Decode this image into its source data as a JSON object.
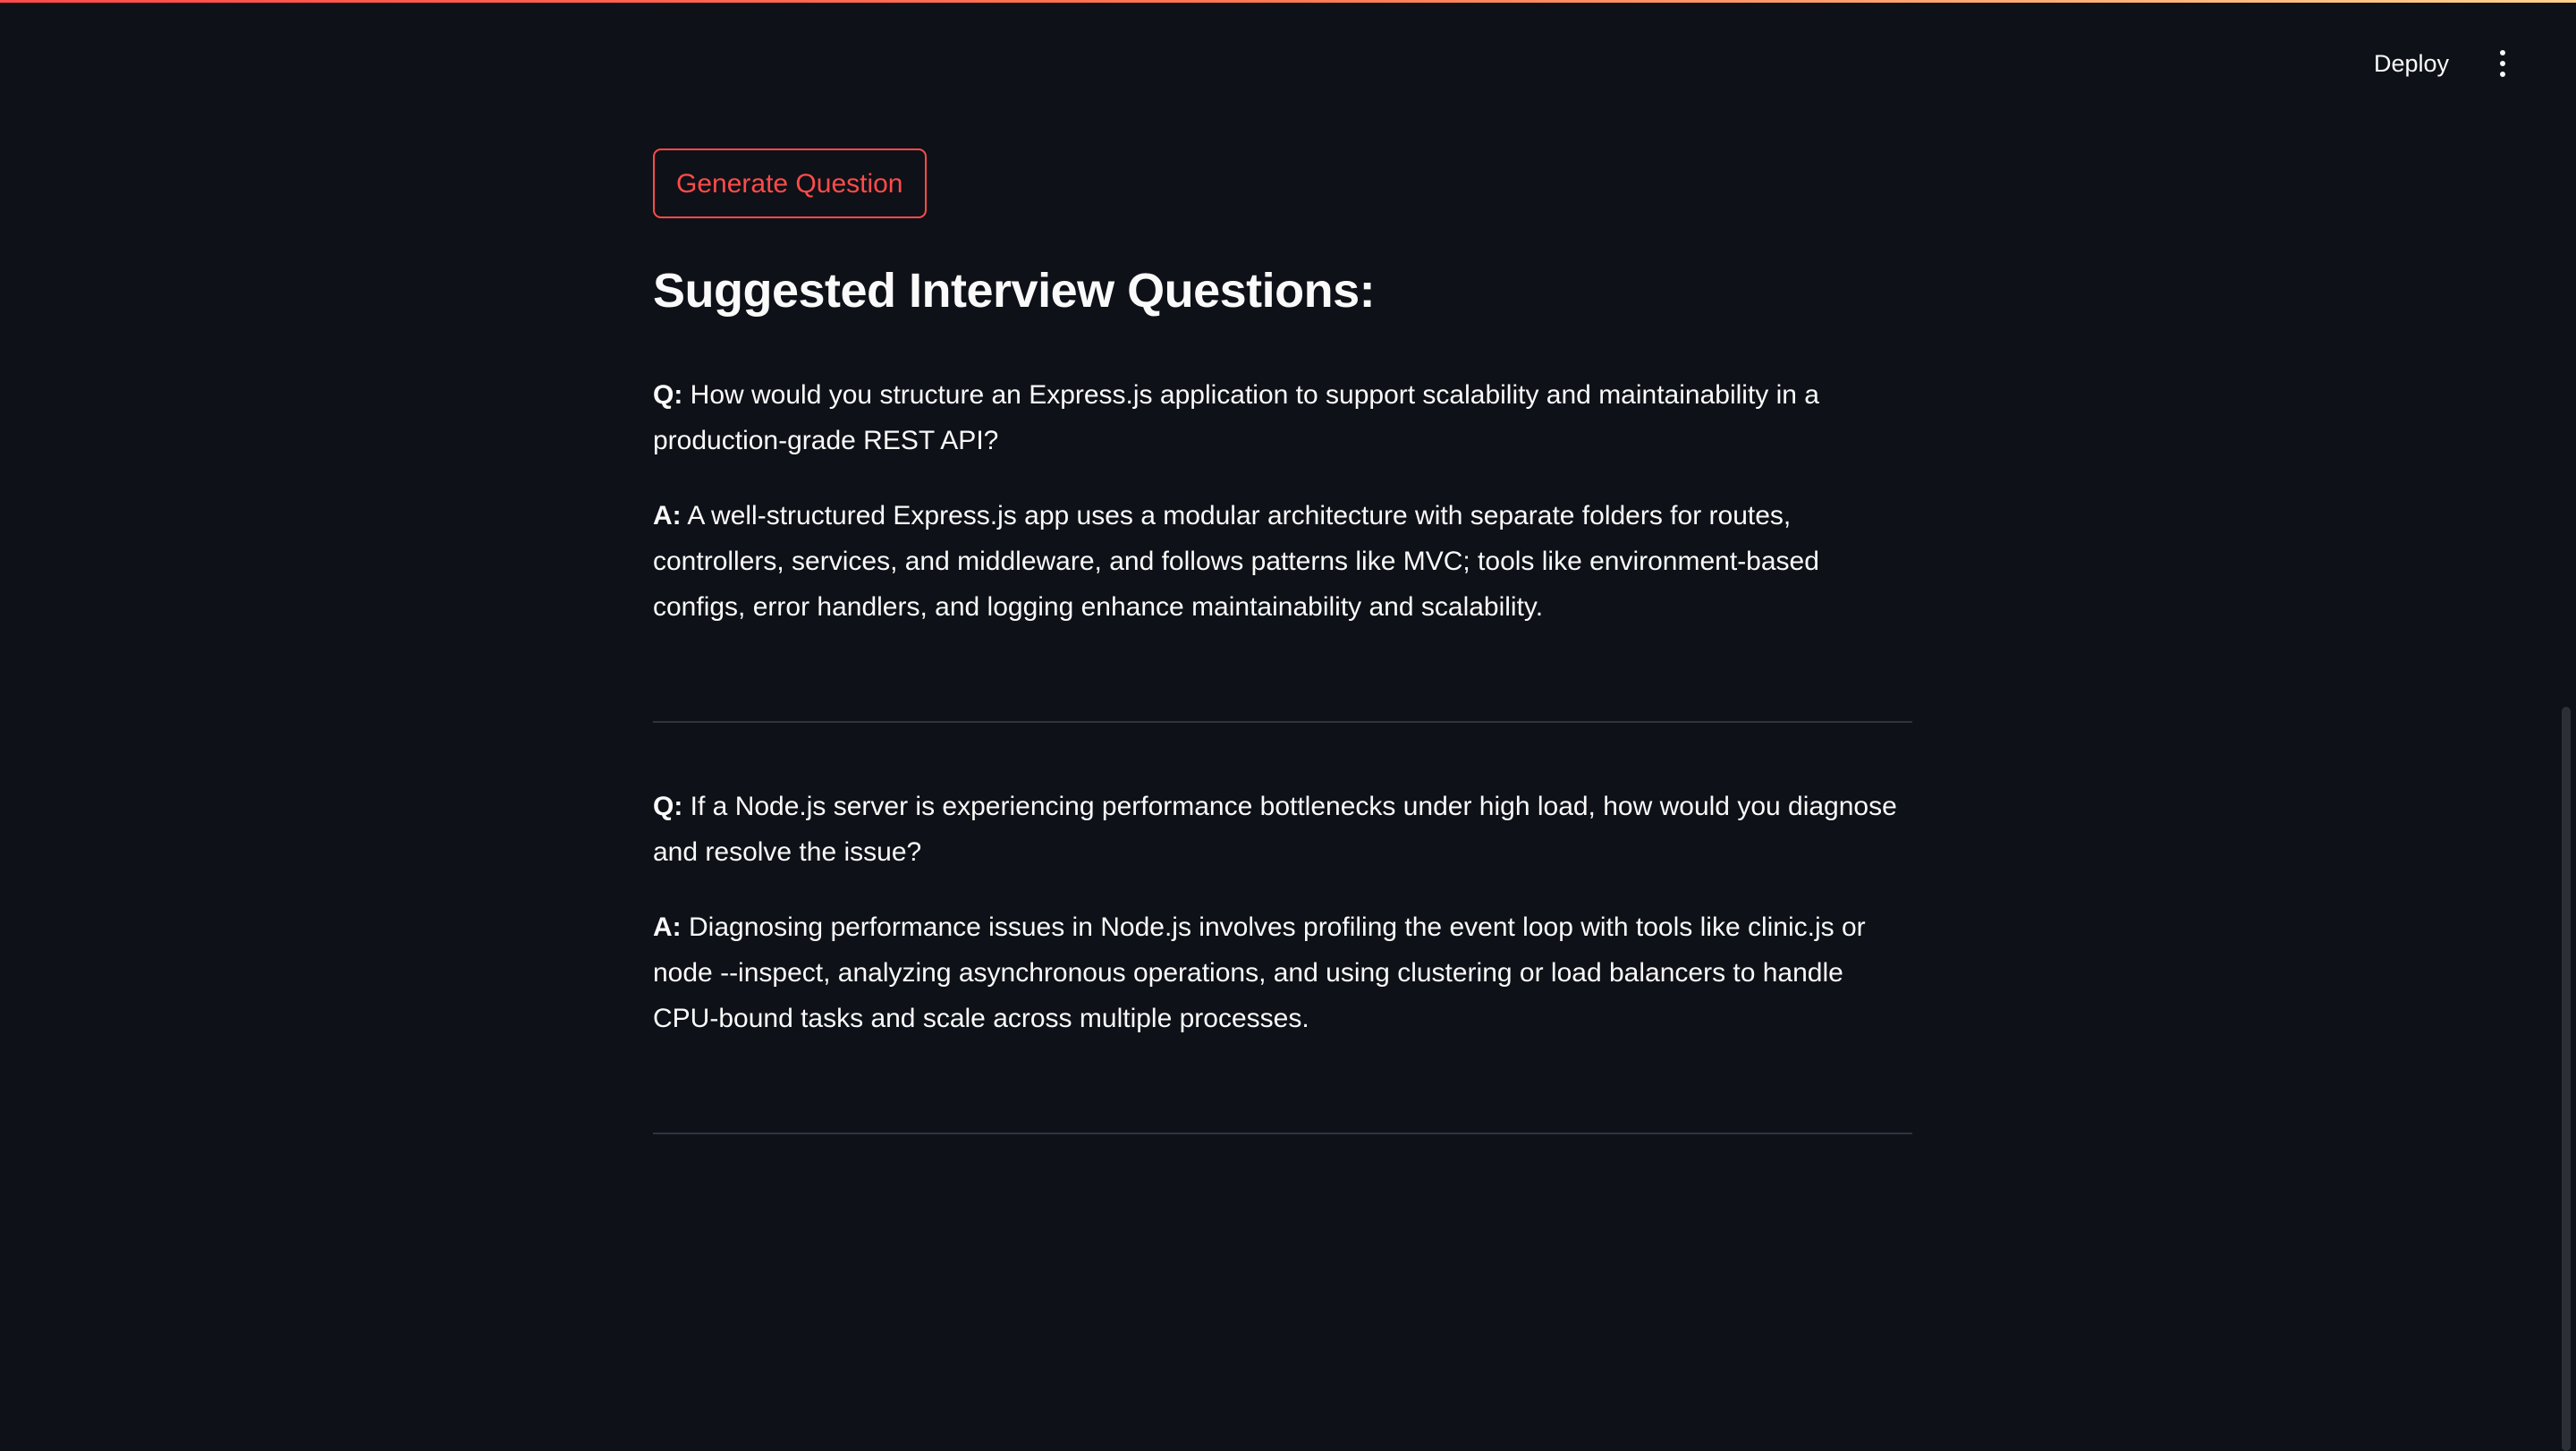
{
  "header": {
    "deploy_label": "Deploy",
    "menu_icon": "vertical-dots-icon"
  },
  "main": {
    "generate_button_label": "Generate Question",
    "title": "Suggested Interview Questions:",
    "qa": [
      {
        "q_prefix": "Q:",
        "question": "How would you structure an Express.js application to support scalability and maintainability in a production-grade REST API?",
        "a_prefix": "A:",
        "answer": "A well-structured Express.js app uses a modular architecture with separate folders for routes, controllers, services, and middleware, and follows patterns like MVC; tools like environment-based configs, error handlers, and logging enhance maintainability and scalability."
      },
      {
        "q_prefix": "Q:",
        "question": "If a Node.js server is experiencing performance bottlenecks under high load, how would you diagnose and resolve the issue?",
        "a_prefix": "A:",
        "answer": "Diagnosing performance issues in Node.js involves profiling the event loop with tools like clinic.js or node --inspect, analyzing asynchronous operations, and using clustering or load balancers to handle CPU-bound tasks and scale across multiple processes."
      }
    ]
  },
  "colors": {
    "background": "#0e1117",
    "accent": "#ff4b4b",
    "text": "#fafafa",
    "divider": "#31333f"
  }
}
